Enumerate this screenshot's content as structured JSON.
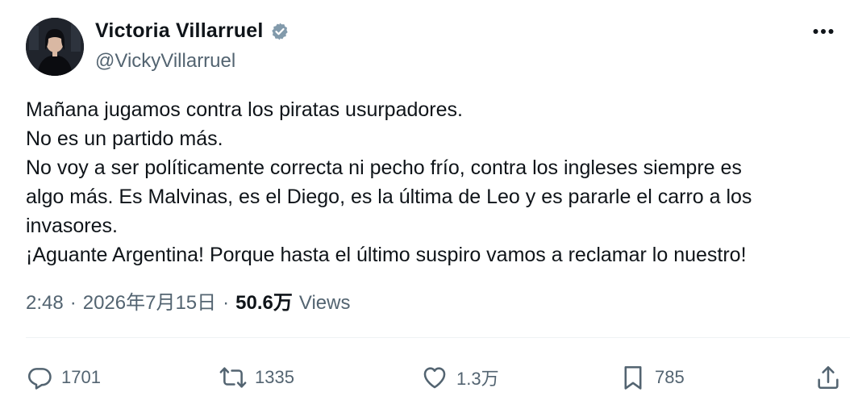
{
  "author": {
    "display_name": "Victoria Villarruel",
    "handle": "@VickyVillarruel",
    "verified": true,
    "verified_color": "#536471"
  },
  "more_icon": "more-horizontal-icon",
  "body": {
    "lines": [
      "Mañana jugamos contra los piratas usurpadores.",
      "No es un partido más.",
      "No voy a ser políticamente correcta ni pecho frío, contra los ingleses siempre es",
      "algo más.  Es Malvinas, es el Diego, es la última de Leo y es pararle el carro a los",
      "invasores.",
      "¡Aguante Argentina! Porque hasta el último suspiro vamos a reclamar lo nuestro!"
    ]
  },
  "meta": {
    "time": "2:48",
    "separator": "·",
    "date": "2026年7月15日",
    "views_count": "50.6万",
    "views_label": "Views"
  },
  "actions": {
    "reply": {
      "icon": "reply-icon",
      "count": "1701"
    },
    "retweet": {
      "icon": "retweet-icon",
      "count": "1335"
    },
    "like": {
      "icon": "heart-icon",
      "count": "1.3万"
    },
    "bookmark": {
      "icon": "bookmark-icon",
      "count": "785"
    },
    "share": {
      "icon": "share-icon"
    }
  },
  "colors": {
    "text_primary": "#0f1419",
    "text_secondary": "#536471",
    "divider": "#eff3f4"
  }
}
